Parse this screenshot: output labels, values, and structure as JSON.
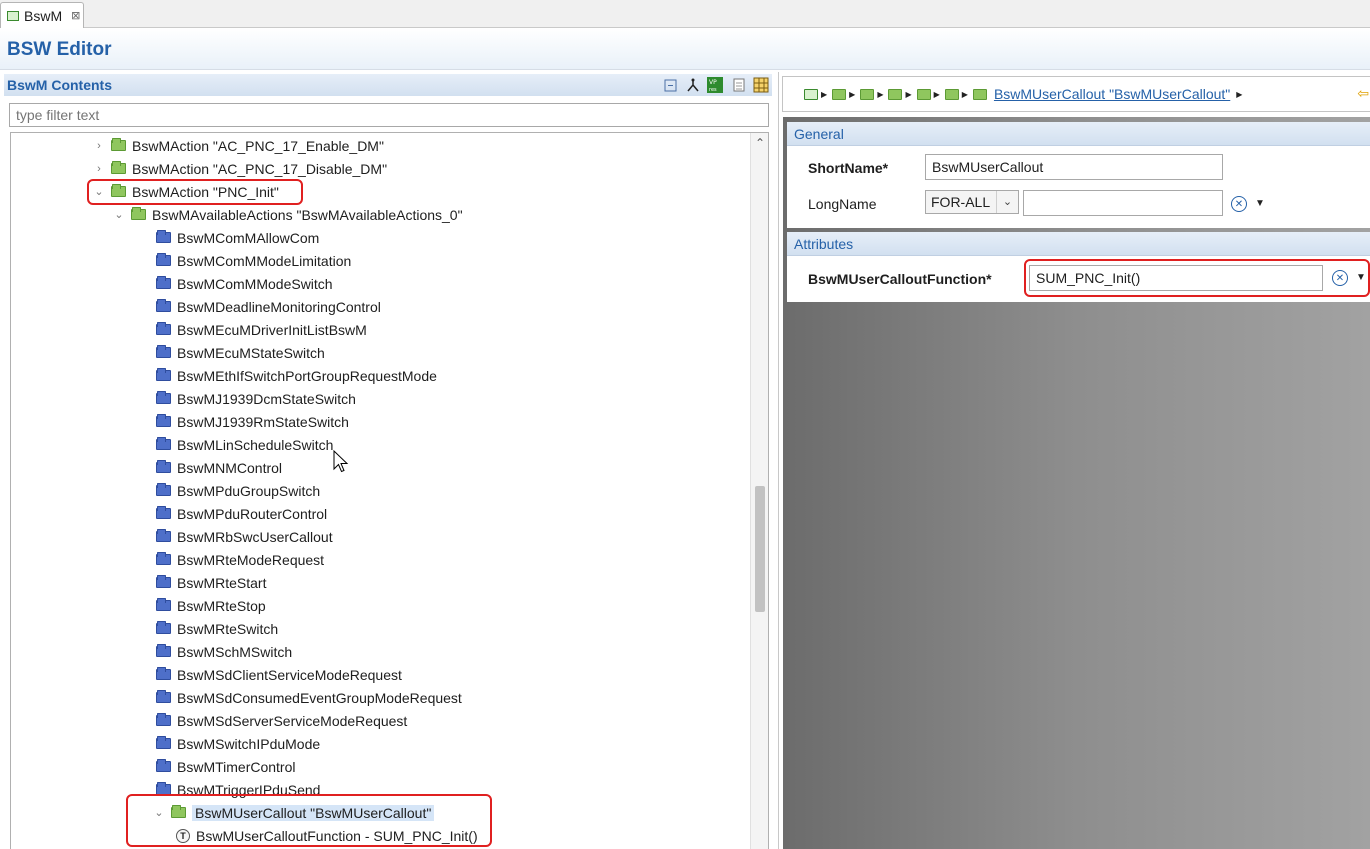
{
  "tab": {
    "label": "BswM",
    "close": "⊠"
  },
  "editor": {
    "title": "BSW Editor"
  },
  "left": {
    "title": "BswM Contents",
    "filter_placeholder": "type filter text",
    "tools": [
      "collapse-all-icon",
      "link-icon",
      "vp-res-icon",
      "document-icon",
      "grid-icon"
    ]
  },
  "tree": {
    "rows": [
      {
        "label": "BswMAction \"AC_PNC_17_Enable_DM\"",
        "level": 1,
        "arrow": "›",
        "icon": "green"
      },
      {
        "label": "BswMAction \"AC_PNC_17_Disable_DM\"",
        "level": 1,
        "arrow": "›",
        "icon": "green"
      },
      {
        "label": "BswMAction \"PNC_Init\"",
        "level": 1,
        "arrow": "⌄",
        "icon": "green"
      },
      {
        "label": "BswMAvailableActions \"BswMAvailableActions_0\"",
        "level": 2,
        "arrow": "⌄",
        "icon": "green"
      },
      {
        "label": "BswMComMAllowCom",
        "level": 3,
        "icon": "blue"
      },
      {
        "label": "BswMComMModeLimitation",
        "level": 3,
        "icon": "blue"
      },
      {
        "label": "BswMComMModeSwitch",
        "level": 3,
        "icon": "blue"
      },
      {
        "label": "BswMDeadlineMonitoringControl",
        "level": 3,
        "icon": "blue"
      },
      {
        "label": "BswMEcuMDriverInitListBswM",
        "level": 3,
        "icon": "blue"
      },
      {
        "label": "BswMEcuMStateSwitch",
        "level": 3,
        "icon": "blue"
      },
      {
        "label": "BswMEthIfSwitchPortGroupRequestMode",
        "level": 3,
        "icon": "blue"
      },
      {
        "label": "BswMJ1939DcmStateSwitch",
        "level": 3,
        "icon": "blue"
      },
      {
        "label": "BswMJ1939RmStateSwitch",
        "level": 3,
        "icon": "blue"
      },
      {
        "label": "BswMLinScheduleSwitch",
        "level": 3,
        "icon": "blue"
      },
      {
        "label": "BswMNMControl",
        "level": 3,
        "icon": "blue"
      },
      {
        "label": "BswMPduGroupSwitch",
        "level": 3,
        "icon": "blue"
      },
      {
        "label": "BswMPduRouterControl",
        "level": 3,
        "icon": "blue"
      },
      {
        "label": "BswMRbSwcUserCallout",
        "level": 3,
        "icon": "blue"
      },
      {
        "label": "BswMRteModeRequest",
        "level": 3,
        "icon": "blue"
      },
      {
        "label": "BswMRteStart",
        "level": 3,
        "icon": "blue"
      },
      {
        "label": "BswMRteStop",
        "level": 3,
        "icon": "blue"
      },
      {
        "label": "BswMRteSwitch",
        "level": 3,
        "icon": "blue"
      },
      {
        "label": "BswMSchMSwitch",
        "level": 3,
        "icon": "blue"
      },
      {
        "label": "BswMSdClientServiceModeRequest",
        "level": 3,
        "icon": "blue"
      },
      {
        "label": "BswMSdConsumedEventGroupModeRequest",
        "level": 3,
        "icon": "blue"
      },
      {
        "label": "BswMSdServerServiceModeRequest",
        "level": 3,
        "icon": "blue"
      },
      {
        "label": "BswMSwitchIPduMode",
        "level": 3,
        "icon": "blue"
      },
      {
        "label": "BswMTimerControl",
        "level": 3,
        "icon": "blue"
      },
      {
        "label": "BswMTriggerIPduSend",
        "level": 3,
        "icon": "blue"
      },
      {
        "label": "BswMUserCallout \"BswMUserCallout\"",
        "level": 3,
        "arrow": "⌄",
        "icon": "green",
        "selected": true
      },
      {
        "label": "BswMUserCalloutFunction - SUM_PNC_Init()",
        "level": 4,
        "icon": "t"
      }
    ]
  },
  "breadcrumb": {
    "link": "BswMUserCallout \"BswMUserCallout\""
  },
  "general": {
    "title": "General",
    "shortname_label": "ShortName*",
    "shortname_value": "BswMUserCallout",
    "longname_label": "LongName",
    "lang_value": "FOR-ALL",
    "longname_value": ""
  },
  "attributes": {
    "title": "Attributes",
    "func_label": "BswMUserCalloutFunction*",
    "func_value": "SUM_PNC_Init()"
  },
  "colors": {
    "accent": "#2561a8",
    "highlight": "#e02020",
    "green_folder": "#8fc65e",
    "blue_folder": "#4e6fc9"
  }
}
